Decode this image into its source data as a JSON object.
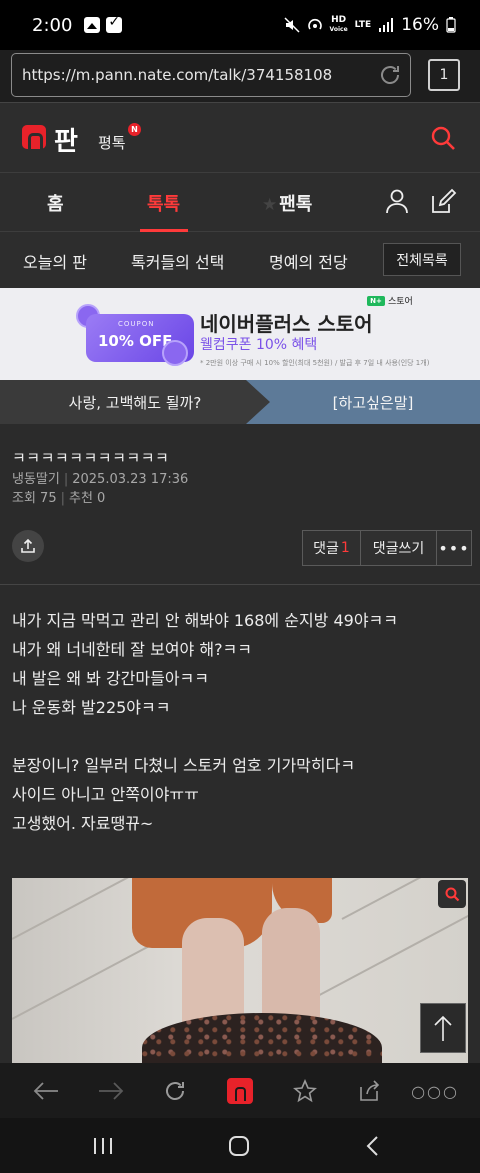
{
  "status_bar": {
    "time": "2:00",
    "network_hd": "HD",
    "network_hd_sub": "Voice",
    "network_lte": "LTE",
    "battery": "16%"
  },
  "browser": {
    "url": "https://m.pann.nate.com/talk/374158108",
    "tab_count": "1"
  },
  "header": {
    "logo_text": "판",
    "logo_sub": "평톡",
    "logo_badge": "N"
  },
  "main_tabs": [
    {
      "label": "홈"
    },
    {
      "label": "톡톡",
      "active": true
    },
    {
      "label": "팬톡"
    }
  ],
  "sub_nav": {
    "items": [
      "오늘의 판",
      "톡커들의 선택",
      "명예의 전당"
    ],
    "all_button": "전체목록"
  },
  "ad": {
    "coupon_top": "COUPON",
    "coupon_main": "10% OFF",
    "brand": "스토어",
    "brand_badge": "N+",
    "title": "네이버플러스 스토어",
    "subtitle": "웰컴쿠폰 10% 혜택",
    "fine_print": "* 2만원 이상 구매 시 10% 할인(최대 5천원) / 발급 후 7일 내 사용(인당 1개)"
  },
  "category_bar": {
    "left": "사랑, 고백해도 될까?",
    "right": "[하고싶은말]"
  },
  "post": {
    "title": "ㅋㅋㅋㅋㅋㅋㅋㅋㅋㅋㅋ",
    "author": "냉동딸기",
    "date": "2025.03.23 17:36",
    "views": "조회 75",
    "recommends": "추천 0",
    "comment_label": "댓글",
    "comment_count": "1",
    "write_comment_label": "댓글쓰기",
    "more_label": "•••",
    "body_lines": [
      "내가 지금 막먹고 관리 안 해봐야 168에 순지방 49야ㅋㅋ",
      "내가 왜 너네한테 잘 보여야 해?ㅋㅋ",
      "내 발은 왜 봐 강간마들아ㅋㅋ",
      "나 운동화 발225야ㅋㅋ",
      "",
      "분장이니? 일부러 다쳤니 스토커 엄호 기가막히다ㅋ",
      "사이드 아니고 안쪽이야ㅠㅠ",
      "고생했어. 자료땡뀨~"
    ]
  },
  "colors": {
    "accent": "#ff3a3a",
    "brand_red": "#e8222a",
    "category_blue": "#5d7a98",
    "ad_purple": "#7b52e8",
    "background": "#2b2b2b"
  },
  "icons": {
    "reload": "reload-icon",
    "search": "search-icon",
    "user": "user-icon",
    "edit": "edit-icon",
    "share": "share-icon",
    "zoom": "zoom-icon",
    "scroll_top": "arrow-up-icon"
  }
}
